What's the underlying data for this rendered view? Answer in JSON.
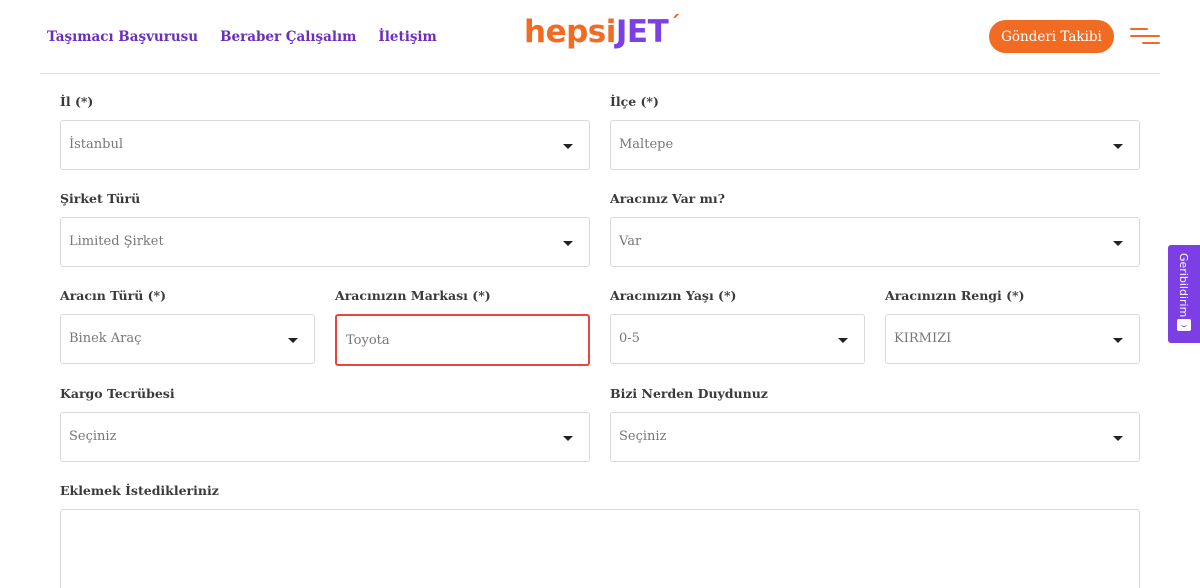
{
  "header": {
    "nav": [
      "Taşımacı Başvurusu",
      "Beraber Çalışalım",
      "İletişim"
    ],
    "logo": {
      "part1": "hepsi",
      "part2": "JET",
      "mark": "´"
    },
    "track_button": "Gönderi Takibi",
    "menu_icon": "hamburger-menu-icon"
  },
  "form": {
    "il": {
      "label": "İl (*)",
      "value": "İstanbul"
    },
    "ilce": {
      "label": "İlçe (*)",
      "value": "Maltepe"
    },
    "sirket_turu": {
      "label": "Şirket Türü",
      "value": "Limited Şirket"
    },
    "arac_var_mi": {
      "label": "Aracınız Var mı?",
      "value": "Var"
    },
    "arac_turu": {
      "label": "Aracın Türü (*)",
      "value": "Binek Araç"
    },
    "arac_markasi": {
      "label": "Aracınızın Markası (*)",
      "value": "Toyota"
    },
    "arac_yasi": {
      "label": "Aracınızın Yaşı (*)",
      "value": "0-5"
    },
    "arac_rengi": {
      "label": "Aracınızın Rengi (*)",
      "value": "KIRMIZI"
    },
    "kargo_tecrubesi": {
      "label": "Kargo Tecrübesi",
      "value": "Seçiniz"
    },
    "bizi_nerden": {
      "label": "Bizi Nerden Duydunuz",
      "value": "Seçiniz"
    },
    "eklemek": {
      "label": "Eklemek İstedikleriniz",
      "value": ""
    }
  },
  "feedback_tab": {
    "label": "Geribildirim",
    "icon": "smiley-icon"
  },
  "colors": {
    "accent": "#f26b22",
    "brand": "#7b3fe4",
    "nav": "#6b2ebd",
    "error": "#e5483f"
  }
}
